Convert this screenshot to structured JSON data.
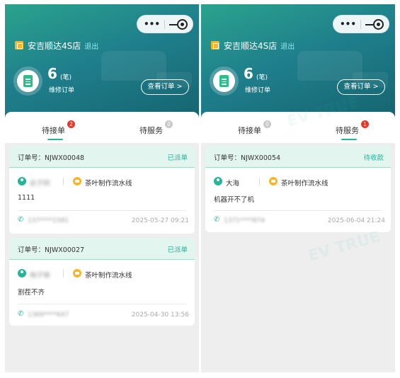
{
  "capsule": {
    "more": "•••"
  },
  "left": {
    "store_name": "安吉顺达4S店",
    "logout": "退出",
    "count": "6",
    "count_unit": "(笔)",
    "count_label": "维修订单",
    "view_orders_label": "查看订单 >",
    "tabs": [
      {
        "label": "待接单",
        "badge": "2"
      },
      {
        "label": "待服务",
        "badge": "0"
      }
    ],
    "orders": [
      {
        "order_label": "订单号：NJWX00048",
        "status": "已派单",
        "person": "俞子刚",
        "factory": "茶叶制作流水线",
        "description": "1111",
        "phone": "137****1581",
        "date": "2025-05-27 09:21"
      },
      {
        "order_label": "订单号：NJWX00027",
        "status": "已派单",
        "person": "梅子琳",
        "factory": "茶叶制作流水线",
        "description": "割茬不齐",
        "phone": "1369****647",
        "date": "2025-04-30 13:56"
      }
    ]
  },
  "right": {
    "store_name": "安吉顺达4S店",
    "logout": "退出",
    "count": "6",
    "count_unit": "(笔)",
    "count_label": "维修订单",
    "view_orders_label": "查看订单 >",
    "tabs": [
      {
        "label": "待接单",
        "badge": "0"
      },
      {
        "label": "待服务",
        "badge": "1"
      }
    ],
    "orders": [
      {
        "order_label": "订单号：NJWX00054",
        "status": "待收款",
        "person": "大海",
        "factory": "茶叶制作流水线",
        "description": "机器开不了机",
        "phone": "1371****874",
        "date": "2025-06-04 21:24"
      }
    ]
  },
  "colors": {
    "accent": "#27b59a",
    "badge_red": "#e23a2d",
    "icon_orange": "#f5b62c",
    "hero_start": "#2aa38d",
    "hero_end": "#14636e"
  },
  "icons": [
    "store-icon",
    "order-doc-icon",
    "person-icon",
    "factory-icon",
    "phone-icon",
    "more-dots-icon",
    "minimize-icon",
    "close-target-icon"
  ]
}
